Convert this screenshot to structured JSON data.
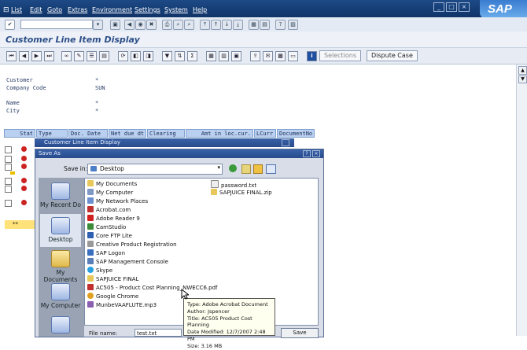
{
  "menu": [
    "List",
    "Edit",
    "Goto",
    "Extras",
    "Environment",
    "Settings",
    "System",
    "Help"
  ],
  "brand": "SAP",
  "page_title": "Customer Line Item Display",
  "app_toolbar": {
    "selections_label": "Selections",
    "dispute_case_label": "Dispute Case"
  },
  "header_fields": {
    "customer_label": "Customer",
    "customer_value": "*",
    "company_code_label": "Company Code",
    "company_code_value": "SUN",
    "name_label": "Name",
    "name_value": "*",
    "city_label": "City",
    "city_value": "*"
  },
  "columns": [
    "Stat",
    "Type",
    "Doc. Date",
    "Net due dt",
    "Clearing",
    "Amt in loc.cur.",
    "LCurr",
    "DocumentNo"
  ],
  "total_marker": "**",
  "inner_dialog_title": "Customer Line Item Display",
  "save_as": {
    "title": "Save As",
    "save_in_label": "Save in:",
    "save_in_value": "Desktop",
    "places": [
      "My Recent Do",
      "Desktop",
      "My Documents",
      "My Computer"
    ],
    "files_left": [
      "My Documents",
      "My Computer",
      "My Network Places",
      "Acrobat.com",
      "Adobe Reader 9",
      "CamStudio",
      "Core FTP Lite",
      "Creative Product Registration",
      "SAP Logon",
      "SAP Management Console",
      "Skype",
      "SAPJUICE FINAL",
      "AC505 - Product Cost Planning_NWECC6.pdf",
      "Google Chrome",
      "MunbeVAAFLUTE.mp3"
    ],
    "files_right": [
      "password.txt",
      "SAPJUICE FINAL.zip"
    ],
    "file_name_label": "File name:",
    "file_name_value": "test.txt",
    "save_button": "Save"
  },
  "tooltip": {
    "type": "Type: Adobe Acrobat Document",
    "author": "Author: Jspencer",
    "title": "Title: AC505 Product Cost Planning",
    "date": "Date Modified: 12/7/2007 2:48 PM",
    "size": "Size: 3.16 MB"
  },
  "colors": {
    "menubar": "#1d4a86",
    "title": "#2d4f88",
    "column_header": "#b9d0f0",
    "status_red": "#cc2222"
  }
}
